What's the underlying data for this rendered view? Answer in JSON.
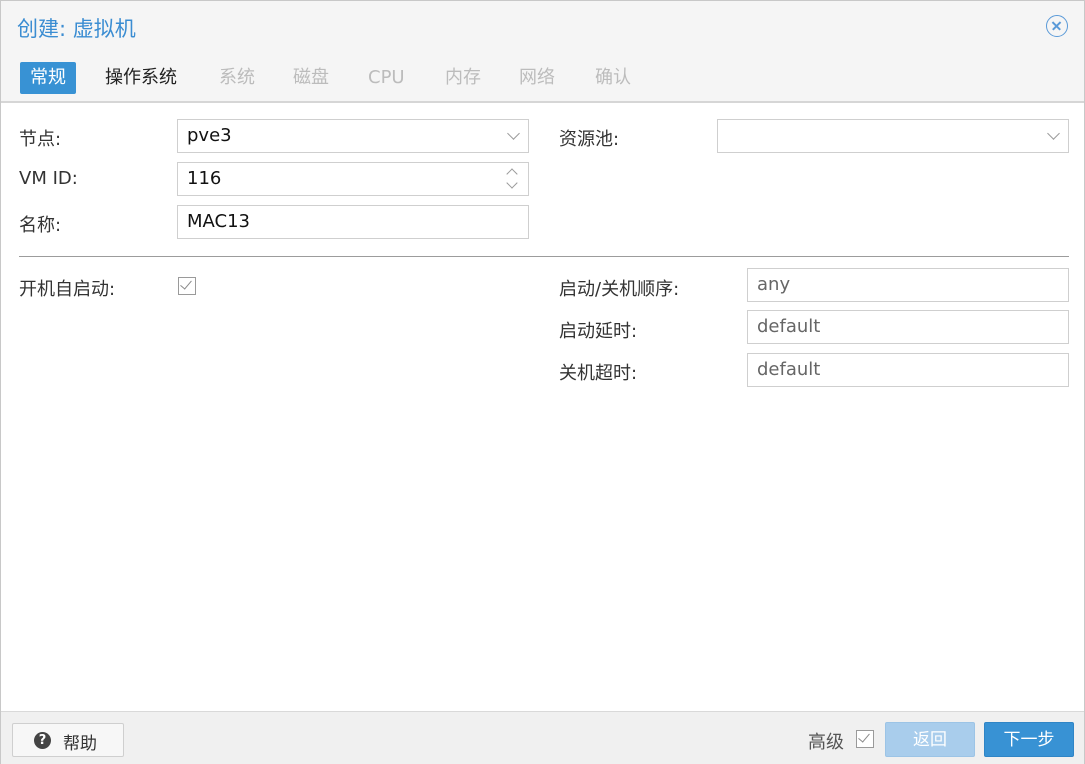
{
  "window": {
    "title": "创建: 虚拟机"
  },
  "tabs": [
    {
      "label": "常规",
      "state": "active"
    },
    {
      "label": "操作系统",
      "state": "enabled"
    },
    {
      "label": "系统",
      "state": "disabled"
    },
    {
      "label": "磁盘",
      "state": "disabled"
    },
    {
      "label": "CPU",
      "state": "disabled"
    },
    {
      "label": "内存",
      "state": "disabled"
    },
    {
      "label": "网络",
      "state": "disabled"
    },
    {
      "label": "确认",
      "state": "disabled"
    }
  ],
  "form": {
    "node": {
      "label": "节点:",
      "value": "pve3"
    },
    "vmid": {
      "label": "VM ID:",
      "value": "116"
    },
    "name": {
      "label": "名称:",
      "value": "MAC13"
    },
    "pool": {
      "label": "资源池:",
      "value": ""
    },
    "onboot": {
      "label": "开机自启动:",
      "checked": true
    },
    "startup_order": {
      "label": "启动/关机顺序:",
      "value": "any"
    },
    "startup_delay": {
      "label": "启动延时:",
      "value": "default"
    },
    "shutdown_timeout": {
      "label": "关机超时:",
      "value": "default"
    }
  },
  "footer": {
    "help_label": "帮助",
    "advanced_label": "高级",
    "advanced_checked": true,
    "back_label": "返回",
    "next_label": "下一步"
  },
  "colors": {
    "accent": "#3892d4",
    "title": "#3b8dd2",
    "disabled_button": "#a9cdec"
  }
}
